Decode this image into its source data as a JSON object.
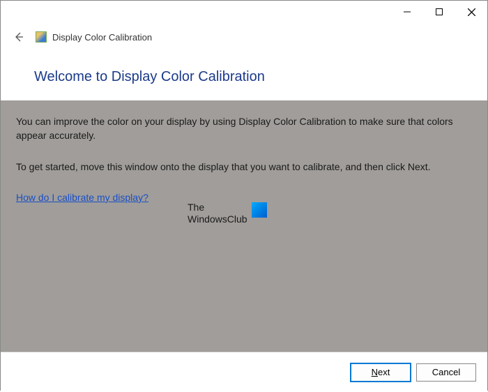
{
  "window": {
    "app_title": "Display Color Calibration"
  },
  "page": {
    "heading": "Welcome to Display Color Calibration",
    "paragraph1": "You can improve the color on your display by using Display Color Calibration to make sure that colors appear accurately.",
    "paragraph2": "To get started, move this window onto the display that you want to calibrate, and then click Next.",
    "help_link": "How do I calibrate my display?"
  },
  "watermark": {
    "line1": "The",
    "line2": "WindowsClub"
  },
  "footer": {
    "next_label": "Next",
    "cancel_label": "Cancel"
  }
}
